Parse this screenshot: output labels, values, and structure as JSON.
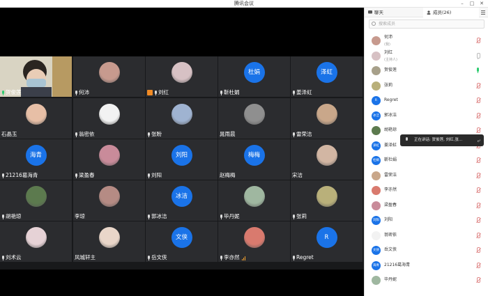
{
  "window": {
    "title": "腾讯会议",
    "min": "–",
    "max": "□",
    "close": "✕"
  },
  "tiles": [
    {
      "name": "贺俊莲",
      "mic": "green",
      "kind": "camera"
    },
    {
      "name": "何沛",
      "mic": "on",
      "kind": "photo",
      "color": "#c79a8e"
    },
    {
      "name": "刘红",
      "mic": "on",
      "host": true,
      "kind": "photo",
      "color": "#d7c1c4"
    },
    {
      "name": "靳杜娟",
      "mic": "on",
      "kind": "blue",
      "avatar_text": "杜娟"
    },
    {
      "name": "姜泽虹",
      "mic": "on",
      "kind": "blue",
      "avatar_text": "泽虹"
    },
    {
      "name": "石晶玉",
      "mic": "",
      "kind": "photo",
      "color": "#e7bfa6"
    },
    {
      "name": "翁密依",
      "mic": "on",
      "kind": "photo",
      "color": "#f2f2f2"
    },
    {
      "name": "张盼",
      "mic": "on",
      "kind": "photo",
      "color": "#9fb3d1"
    },
    {
      "name": "晁雨晨",
      "mic": "",
      "kind": "photo",
      "color": "#8f8f8f"
    },
    {
      "name": "雷荣洁",
      "mic": "on",
      "kind": "photo",
      "color": "#c9a78a"
    },
    {
      "name": "21216葛海青",
      "mic": "on",
      "kind": "blue",
      "avatar_text": "海青"
    },
    {
      "name": "梁盈春",
      "mic": "on",
      "kind": "photo",
      "color": "#c98b9a"
    },
    {
      "name": "刘阳",
      "mic": "on",
      "kind": "blue",
      "avatar_text": "刘阳"
    },
    {
      "name": "赵梅梅",
      "mic": "",
      "kind": "blue",
      "avatar_text": "梅梅"
    },
    {
      "name": "宋洁",
      "mic": "",
      "kind": "photo",
      "color": "#d2b6a3"
    },
    {
      "name": "胡艳琼",
      "mic": "on",
      "kind": "photo",
      "color": "#5c7a4e"
    },
    {
      "name": "李琼",
      "mic": "",
      "kind": "photo",
      "color": "#b58b84"
    },
    {
      "name": "郭冰洁",
      "mic": "on",
      "kind": "blue",
      "avatar_text": "冰洁"
    },
    {
      "name": "毕丹妮",
      "mic": "on",
      "kind": "photo",
      "color": "#9fb7a0"
    },
    {
      "name": "张莉",
      "mic": "on",
      "kind": "photo",
      "color": "#b9b07a"
    },
    {
      "name": "刘术云",
      "mic": "on",
      "kind": "photo",
      "color": "#e6d2d6"
    },
    {
      "name": "风城轩主",
      "mic": "",
      "kind": "photo",
      "color": "#e9d6c9"
    },
    {
      "name": "岳文侠",
      "mic": "on",
      "kind": "blue",
      "avatar_text": "文侠"
    },
    {
      "name": "李亦然",
      "mic": "on",
      "kind": "photo",
      "color": "#d97a6e",
      "bars": true
    },
    {
      "name": "Regret",
      "mic": "on",
      "kind": "blue",
      "avatar_text": "R"
    }
  ],
  "panel": {
    "tab_chat": "聊天",
    "tab_members": "成员(26)",
    "search_placeholder": "搜索成员",
    "members": [
      {
        "name": "何沛",
        "sub": "(我)",
        "status": "muted",
        "color": "#c79a8e"
      },
      {
        "name": "刘红",
        "sub": "(主持人)",
        "status": "off",
        "color": "#d7c1c4"
      },
      {
        "name": "贺俊莲",
        "status": "on",
        "color": "#a7a08a"
      },
      {
        "name": "张莉",
        "status": "muted",
        "color": "#b9b07a"
      },
      {
        "name": "Regret",
        "status": "muted",
        "blue": "R"
      },
      {
        "name": "郭冰洁",
        "status": "muted",
        "blue": "冰洁"
      },
      {
        "name": "胡艳琼",
        "status": "muted",
        "color": "#5c7a4e"
      },
      {
        "name": "姜泽虹",
        "status": "muted",
        "blue": "泽虹"
      },
      {
        "name": "靳杜娟",
        "status": "muted",
        "blue": "杜娟"
      },
      {
        "name": "雷荣洁",
        "status": "muted",
        "color": "#c9a78a"
      },
      {
        "name": "李亦然",
        "status": "muted",
        "color": "#d97a6e"
      },
      {
        "name": "梁盈春",
        "status": "muted",
        "color": "#c98b9a"
      },
      {
        "name": "刘阳",
        "status": "muted",
        "blue": "刘阳"
      },
      {
        "name": "翁密依",
        "status": "muted",
        "color": "#f2f2f2"
      },
      {
        "name": "岳文侠",
        "status": "muted",
        "blue": "文侠"
      },
      {
        "name": "21216葛海青",
        "status": "muted",
        "blue": "海青"
      },
      {
        "name": "毕丹妮",
        "status": "muted",
        "color": "#9fb7a0"
      }
    ],
    "tooltip": "正在讲话: 贺俊莲, 刘红,张..."
  }
}
